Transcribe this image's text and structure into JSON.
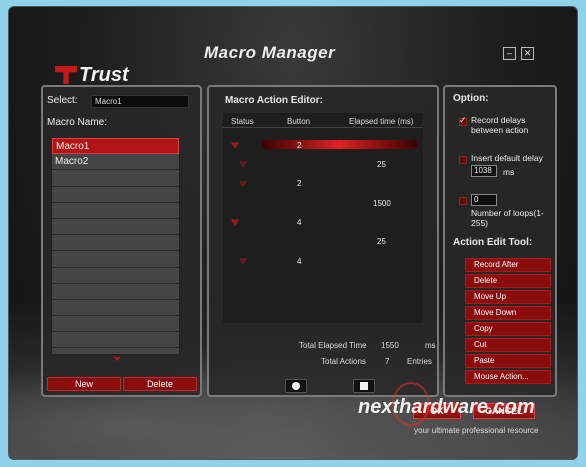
{
  "window": {
    "title": "Macro Manager",
    "brand": "Trust"
  },
  "titlebar": {
    "minimize_glyph": "–",
    "close_glyph": "✕"
  },
  "left": {
    "select_label": "Select:",
    "select_value": "Macro1",
    "macro_name_label": "Macro Name:",
    "macros": [
      "Macro1",
      "Macro2",
      "",
      "",
      "",
      "",
      "",
      "",
      "",
      "",
      "",
      "",
      ""
    ],
    "selected_index": 0,
    "new_label": "New",
    "delete_label": "Delete"
  },
  "editor": {
    "title": "Macro Action Editor:",
    "columns": [
      "Status",
      "Button",
      "Elapsed time (ms)"
    ],
    "actions": [
      {
        "status": "down",
        "button": "2",
        "elapsed": ""
      },
      {
        "status": "up",
        "button": "",
        "elapsed": "25"
      },
      {
        "status": "up",
        "button": "2",
        "elapsed": ""
      },
      {
        "status": "",
        "button": "",
        "elapsed": "1500"
      },
      {
        "status": "down",
        "button": "4",
        "elapsed": ""
      },
      {
        "status": "",
        "button": "",
        "elapsed": "25"
      },
      {
        "status": "up",
        "button": "4",
        "elapsed": ""
      }
    ],
    "total_elapsed_label": "Total Elapsed Time",
    "total_elapsed_value": "1550",
    "total_elapsed_unit": "ms",
    "total_actions_label": "Total Actions",
    "total_actions_value": "7",
    "total_actions_unit": "Entries"
  },
  "option": {
    "title": "Option:",
    "record_delays": "Record delays between action",
    "record_delays_checked": true,
    "insert_default_delay": "Insert default delay",
    "insert_default_delay_checked": false,
    "default_delay_value": "1038",
    "default_delay_unit": "ms",
    "loops_value": "0",
    "loops_label": "Number of loops(1-255)",
    "loops_checked": false
  },
  "tools": {
    "title": "Action Edit Tool:",
    "items": [
      "Record After",
      "Delete",
      "Move Up",
      "Move Down",
      "Copy",
      "Cut",
      "Paste",
      "Mouse Action..."
    ]
  },
  "footer": {
    "ok_label": "OK",
    "cancel_label": "CANCEL"
  },
  "watermark": {
    "main": "nexthardware.com",
    "sub": "your ultimate professional resource"
  },
  "colors": {
    "accent": "#b01414",
    "panel_border": "#7a7a7a",
    "background": "#1c1c1c"
  }
}
